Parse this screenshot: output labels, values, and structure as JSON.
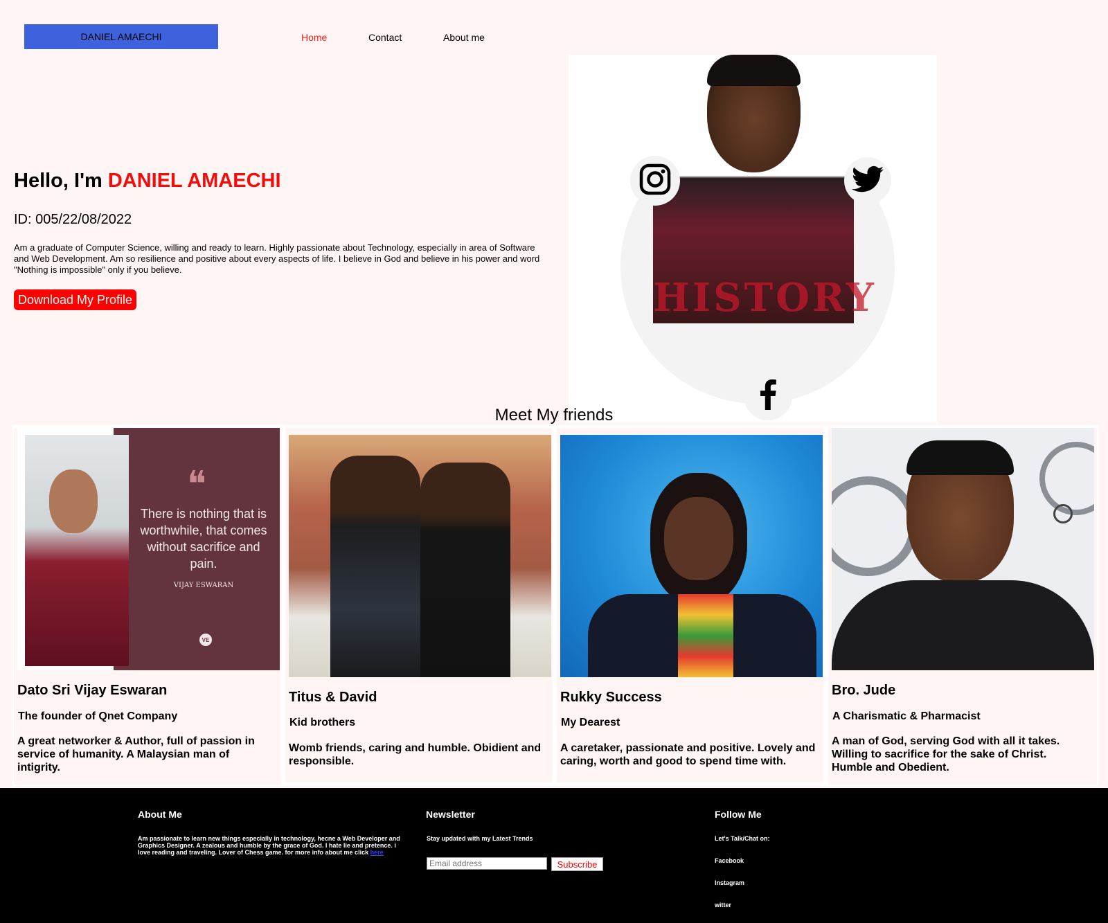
{
  "header": {
    "logo": "DANIEL AMAECHI",
    "nav": [
      "Home",
      "Contact",
      "About me"
    ]
  },
  "hero": {
    "greeting": "Hello, I'm",
    "name": "DANIEL AMAECHI",
    "id_text": "ID: 005/22/08/2022",
    "description": "Am a graduate of Computer Science, willing and ready to learn. Highly passionate about Technology, especially in area of Software and Web Development. Am so resilience and positive about every aspects of life. I believe in God and believe in his power and word \"Nothing is impossible\" only if you believe.",
    "button": "Download My Profile",
    "photo_text": "HISTORY",
    "social_icons": [
      "instagram-icon",
      "twitter-icon",
      "facebook-icon"
    ]
  },
  "friends": {
    "title": "Meet My friends",
    "cards": [
      {
        "name": "Dato Sri Vijay Eswaran",
        "role": "The founder of Qnet Company",
        "desc": "A great networker & Author, full of passion in service of humanity. A Malaysian man of intigrity.",
        "quote": "There is nothing that is worthwhile, that comes without sacrifice and pain.",
        "quote_author": "VIJAY ESWARAN",
        "quote_badge": "VE"
      },
      {
        "name": "Titus & David",
        "role": "Kid brothers",
        "desc": "Womb friends, caring and humble. Obidient and responsible."
      },
      {
        "name": "Rukky Success",
        "role": "My Dearest",
        "desc": "A caretaker, passionate and positive. Lovely and caring, worth and good to spend time with."
      },
      {
        "name": "Bro. Jude",
        "role": "A Charismatic & Pharmacist",
        "desc": "A man of God, serving God with all it takes. Willing to sacrifice for the sake of Christ. Humble and Obedient."
      }
    ]
  },
  "footer": {
    "about": {
      "title": "About Me",
      "text": "Am passionate to learn new things especially in technology, hecne a Web Developer and Graphics Designer. A zealous and humble by the grace of God. I hate lie and pretence. i love reading and traveling. Lover of Chess game. for more info about me click",
      "link": "here"
    },
    "newsletter": {
      "title": "Newsletter",
      "text": "Stay updated with my Latest Trends",
      "placeholder": "Email address",
      "button": "Subscribe"
    },
    "follow": {
      "title": "Follow Me",
      "text": "Let's Talk/Chat on:",
      "links": [
        "Facebook",
        "Instagram",
        "witter"
      ]
    }
  },
  "colors": {
    "page_bg": "#fff5f5",
    "logo_bg": "#3e62dd",
    "accent_red": "#ff0000",
    "footer_bg": "#000000"
  }
}
